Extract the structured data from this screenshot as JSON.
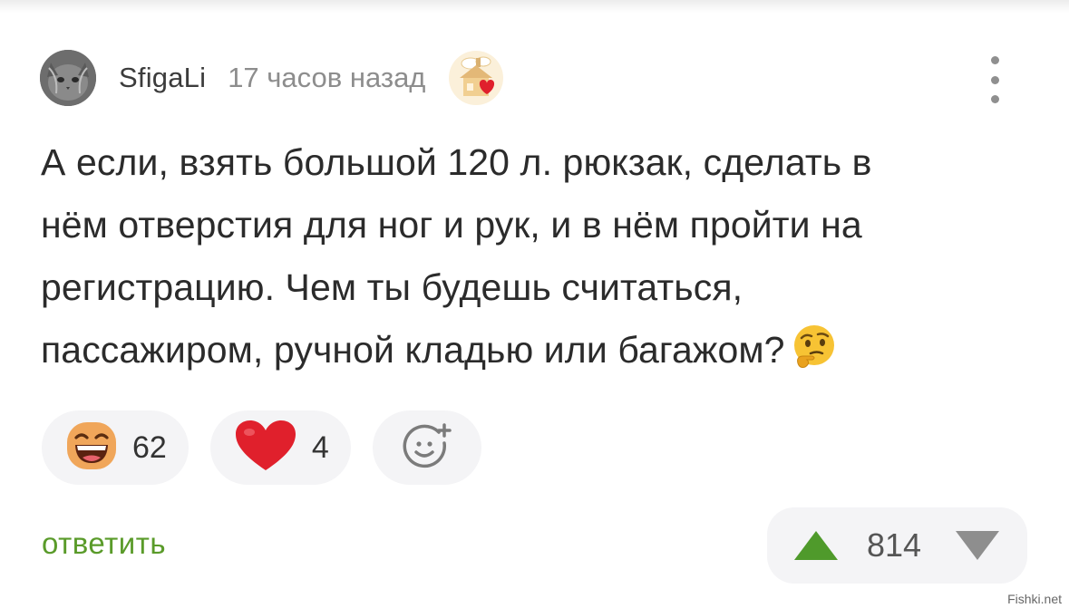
{
  "comment": {
    "author": "SfigaLi",
    "time": "17 часов назад",
    "text_lines": [
      "А если, взять большой 120 л. рюкзак, сделать в",
      "нём отверстия для ног и рук, и в нём пройти на",
      "регистрацию. Чем ты будешь считаться,",
      "пассажиром, ручной кладью или багажом?"
    ],
    "reactions": [
      {
        "icon": "grinning-face-emoji",
        "count": "62"
      },
      {
        "icon": "heart-emoji",
        "count": "4"
      }
    ],
    "reply_label": "ответить",
    "rating": "814"
  },
  "watermark": "Fishki.net",
  "colors": {
    "accent_green": "#5a9b2a",
    "vote_up": "#4f9a2b",
    "vote_down": "#8e8e8e",
    "heart": "#e0202c"
  }
}
